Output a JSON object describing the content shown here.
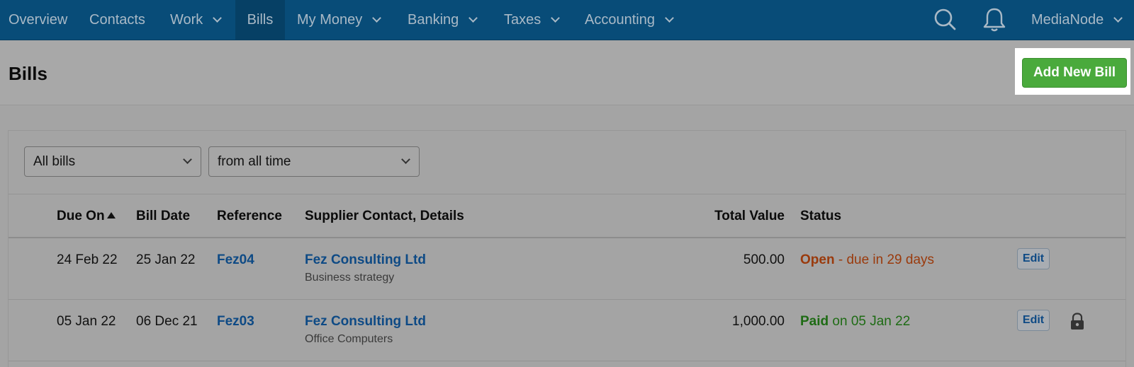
{
  "nav": {
    "items": [
      {
        "label": "Overview"
      },
      {
        "label": "Contacts"
      },
      {
        "label": "Work"
      },
      {
        "label": "Bills"
      },
      {
        "label": "My Money"
      },
      {
        "label": "Banking"
      },
      {
        "label": "Taxes"
      },
      {
        "label": "Accounting"
      }
    ],
    "account_label": "MediaNode",
    "icons": [
      "search-icon",
      "bell-icon"
    ]
  },
  "header": {
    "title": "Bills",
    "add_button": "Add New Bill"
  },
  "filters": {
    "bill_type": "All bills",
    "period": "from all time"
  },
  "table": {
    "columns": [
      "Due On",
      "Bill Date",
      "Reference",
      "Supplier Contact, Details",
      "Total Value",
      "Status"
    ],
    "rows": [
      {
        "due_on": "24 Feb 22",
        "bill_date": "25 Jan 22",
        "reference": "Fez04",
        "supplier": "Fez Consulting Ltd",
        "details": "Business strategy",
        "total": "500.00",
        "status_word": "Open",
        "status_detail": " - due in 29 days",
        "edit": "Edit",
        "locked": false
      },
      {
        "due_on": "05 Jan 22",
        "bill_date": "06 Dec 21",
        "reference": "Fez03",
        "supplier": "Fez Consulting Ltd",
        "details": "Office Computers",
        "total": "1,000.00",
        "status_word": "Paid",
        "status_detail": " on 05 Jan 22",
        "edit": "Edit",
        "locked": true
      }
    ]
  },
  "colors": {
    "nav_bg": "#084c78",
    "add_button": "#4aaa3c",
    "link": "#0e4a85",
    "open_status": "#9a3a0c",
    "paid_status": "#1e6b14"
  }
}
